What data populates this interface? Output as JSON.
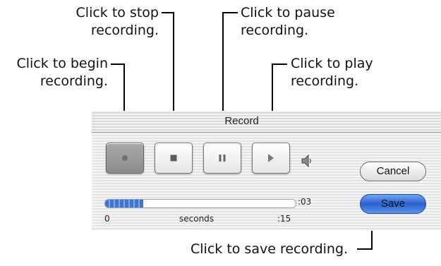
{
  "callouts": {
    "stop": [
      "Click to stop",
      "recording."
    ],
    "pause": [
      "Click to pause",
      "recording."
    ],
    "begin": [
      "Click to begin",
      "recording."
    ],
    "play": [
      "Click to play",
      "recording."
    ],
    "save": "Click to save recording."
  },
  "dialog": {
    "title": "Record",
    "controls": [
      {
        "name": "record",
        "icon": "record-icon",
        "active": true
      },
      {
        "name": "stop",
        "icon": "stop-icon",
        "active": false
      },
      {
        "name": "pause",
        "icon": "pause-icon",
        "active": false
      },
      {
        "name": "play",
        "icon": "play-icon",
        "active": false
      }
    ],
    "speaker_icon": "speaker-icon",
    "progress": {
      "fraction": 0.2,
      "elapsed": ":03",
      "start_label": "0",
      "unit_label": "seconds",
      "end_label": ":15"
    },
    "cancel_label": "Cancel",
    "save_label": "Save"
  },
  "colors": {
    "accent": "#2a5fd0",
    "progress": "#3f74d6"
  }
}
